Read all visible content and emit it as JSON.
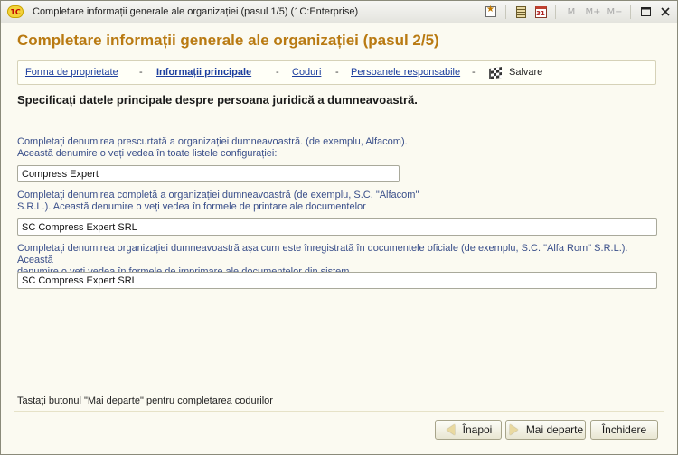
{
  "window": {
    "logo_text": "1C",
    "title": "Completare informații generale ale organizației (pasul 1/5)    (1C:Enterprise)",
    "toolbar": {
      "m_label": "M",
      "m_plus_label": "M+",
      "m_minus_label": "M−",
      "calendar_day": "31"
    }
  },
  "header": {
    "title": "Completare informații generale ale organizației (pasul 2/5)"
  },
  "steps": {
    "items": [
      {
        "label": "Forma de proprietate",
        "state": "link"
      },
      {
        "label": "Informații principale",
        "state": "current"
      },
      {
        "label": "Coduri",
        "state": "link"
      },
      {
        "label": "Persoanele responsabile",
        "state": "link"
      },
      {
        "label": "Salvare",
        "state": "plain"
      }
    ],
    "separator": "-"
  },
  "main": {
    "instruction": "Specificați datele principale despre persoana juridică a dumneavoastră.",
    "fields": [
      {
        "label_line1": "Completați denumirea prescurtată a organizației dumneavoastră. (de exemplu, Alfacom).",
        "label_line2": "Această denumire o veți vedea în toate listele configurației:",
        "value": "Compress Expert"
      },
      {
        "label_line1": "Completați denumirea completă a organizației dumneavoastră (de exemplu, S.C. \"Alfacom\"",
        "label_line2": "S.R.L.). Această denumire o veți vedea în formele de printare ale documentelor",
        "value": "SC Compress Expert SRL"
      },
      {
        "label_line1": "Completați denumirea organizației dumneavoastră așa cum este înregistrată în documentele oficiale (de exemplu, S.C. \"Alfa Rom\" S.R.L.). Această",
        "label_line2": "denumire o veți vedea în formele de imprimare ale documentelor din sistem.",
        "value": "SC Compress Expert SRL"
      }
    ]
  },
  "footer": {
    "hint": "Tastați butonul \"Mai departe\" pentru completarea codurilor",
    "back_label": "Înapoi",
    "next_label": "Mai departe",
    "close_label": "Închidere"
  }
}
